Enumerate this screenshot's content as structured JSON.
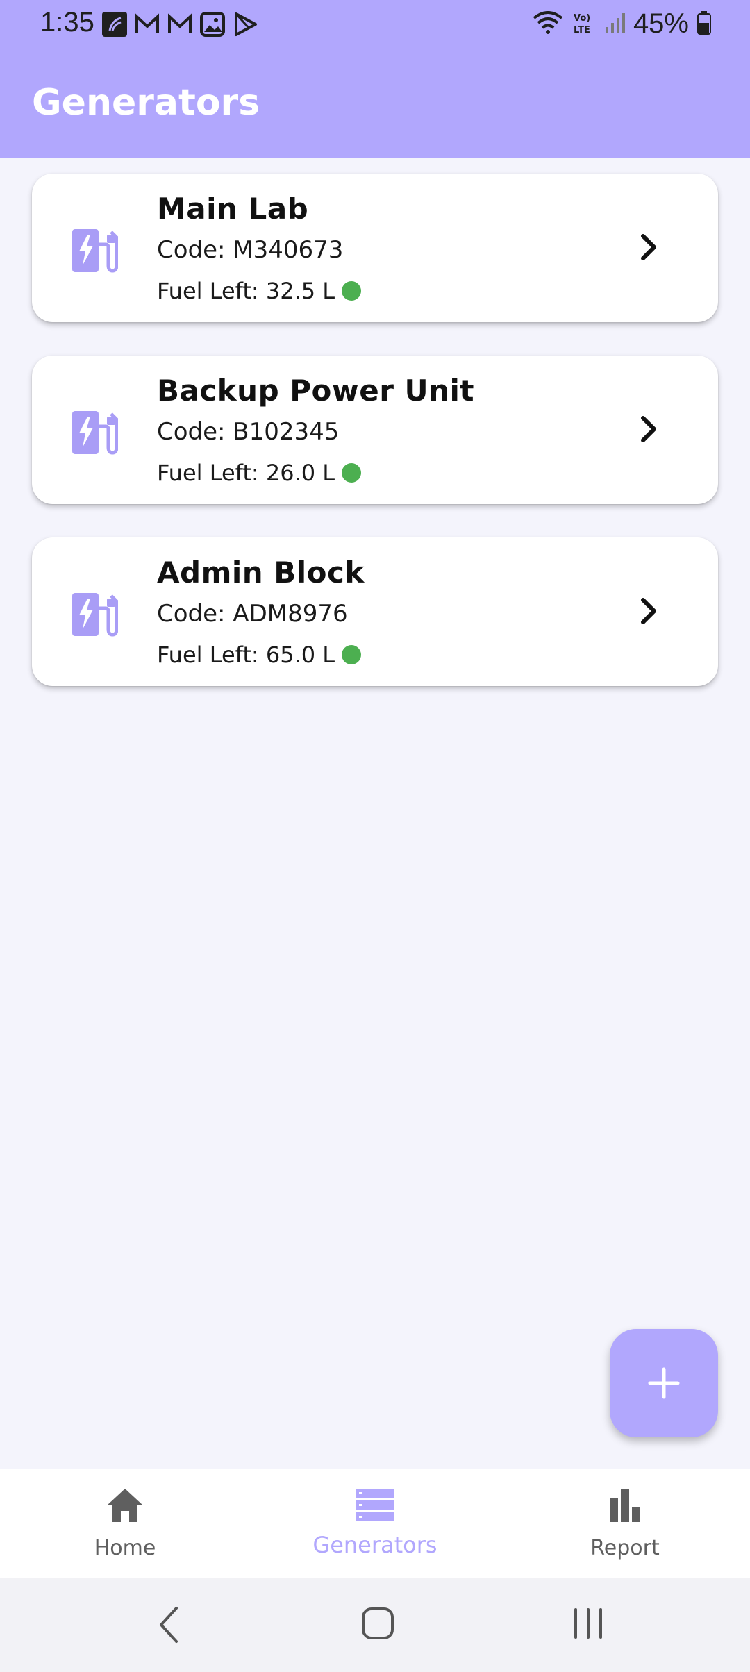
{
  "status_bar": {
    "time": "1:35",
    "battery_percent": "45%",
    "network_label": "Vo) LTE"
  },
  "app_bar": {
    "title": "Generators",
    "color": "#b1a7fd"
  },
  "generators": [
    {
      "name": "Main Lab",
      "code": "Code: M340673",
      "fuel": "Fuel Left: 32.5 L",
      "status_color": "#4caf50"
    },
    {
      "name": "Backup Power Unit",
      "code": "Code: B102345",
      "fuel": "Fuel Left: 26.0 L",
      "status_color": "#4caf50"
    },
    {
      "name": "Admin Block",
      "code": "Code: ADM8976",
      "fuel": "Fuel Left: 65.0 L",
      "status_color": "#4caf50"
    }
  ],
  "fab": {
    "icon": "plus-icon"
  },
  "bottom_nav": {
    "items": [
      {
        "label": "Home",
        "icon": "home-icon",
        "active": false
      },
      {
        "label": "Generators",
        "icon": "list-icon",
        "active": true
      },
      {
        "label": "Report",
        "icon": "bar-chart-icon",
        "active": false
      }
    ]
  },
  "system_nav": {
    "items": [
      "back-icon",
      "home-circle-icon",
      "recents-icon"
    ]
  }
}
